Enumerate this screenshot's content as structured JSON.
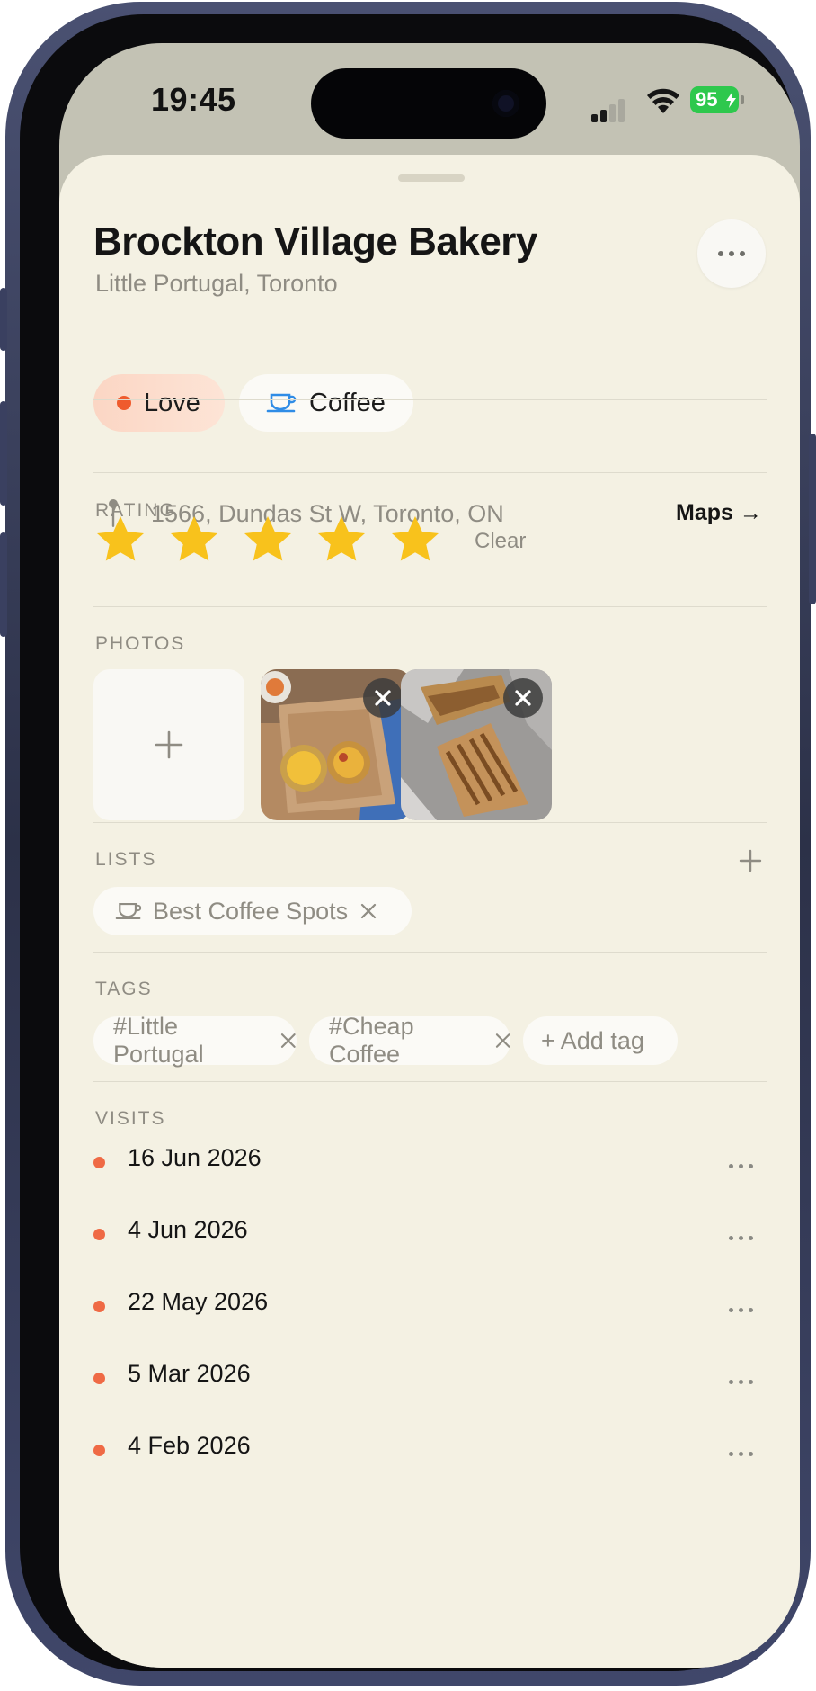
{
  "status_bar": {
    "time": "19:45",
    "battery": "95"
  },
  "place": {
    "name": "Brockton Village Bakery",
    "neighborhood": "Little Portugal, Toronto"
  },
  "category_chips": [
    {
      "label": "Love",
      "color": "#ef5b2d"
    },
    {
      "label": "Coffee",
      "icon": "coffee-cup-icon",
      "color": "#2f8ce6"
    }
  ],
  "address": {
    "text": "1566, Dundas St W, Toronto, ON",
    "maps_label": "Maps →"
  },
  "rating": {
    "label": "RATING",
    "value": 5,
    "max": 5,
    "clear_label": "Clear",
    "star_color": "#f8c21c"
  },
  "photos": {
    "label": "PHOTOS",
    "add_icon": "plus-icon",
    "items": [
      {
        "subject": "egg tarts in cardboard box"
      },
      {
        "subject": "grilled sandwich on foil"
      }
    ]
  },
  "lists": {
    "label": "LISTS",
    "items": [
      {
        "label": "Best Coffee Spots",
        "icon": "coffee-cup-icon"
      }
    ]
  },
  "tags": {
    "label": "TAGS",
    "items": [
      "#Little Portugal",
      "#Cheap Coffee"
    ],
    "add_label": "+ Add tag"
  },
  "visits": {
    "label": "VISITS",
    "items": [
      "16 Jun 2026",
      "4 Jun 2026",
      "22 May 2026",
      "5 Mar 2026",
      "4 Feb 2026"
    ]
  },
  "colors": {
    "sheet_bg": "#f4f1e3",
    "accent": "#ef5b2d",
    "muted_text": "#8f8c83"
  }
}
